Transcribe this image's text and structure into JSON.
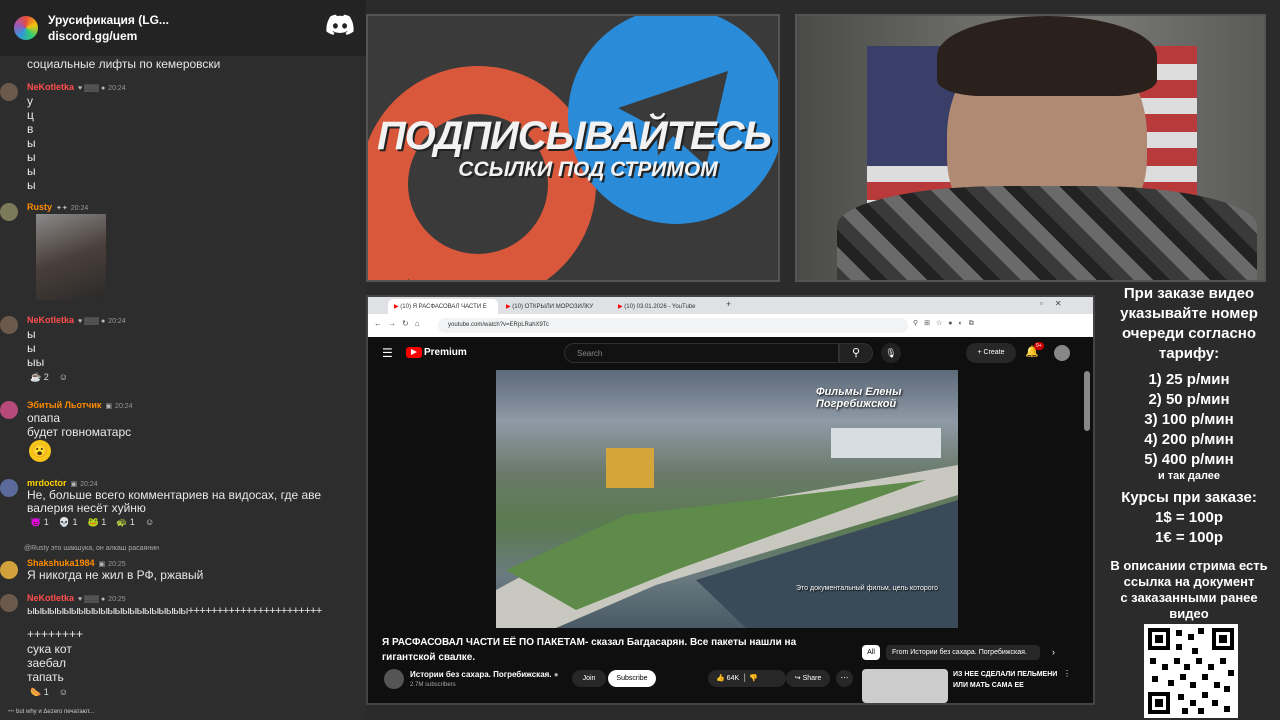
{
  "chat": {
    "server_name": "Урусификация (LG...",
    "server_invite": "discord.gg/uem",
    "partial_top_line": "социальные лифты по  кемеровски",
    "messages": [
      {
        "user": "NeKotletka",
        "time": "20:24",
        "lines": [
          "у",
          "ц",
          "в",
          "ы",
          "ы",
          "ы",
          "ы"
        ]
      },
      {
        "user": "Rusty",
        "time": "20:24",
        "lines": []
      },
      {
        "user": "NeKotletka",
        "time": "20:24",
        "lines": [
          "ы",
          "ы",
          "ыы"
        ],
        "reactions": [
          "2"
        ]
      },
      {
        "user": "Эбитый Льотчик",
        "time": "20:24",
        "lines": [
          "опапа",
          "будет говноматарс"
        ]
      },
      {
        "user": "mrdoctor",
        "time": "20:24",
        "lines": [
          "Не, больше всего комментариев на видосах, где аве",
          "валерия несёт хуйню"
        ],
        "reactions": [
          "1",
          "1",
          "1",
          "1"
        ]
      },
      {
        "user": "Shakshuka1984",
        "time": "20:25",
        "reply": "@Rusty это шакшука, он алкаш расаянин",
        "lines": [
          "Я никогда не жил в РФ, ржавый"
        ]
      },
      {
        "user": "NeKotletka",
        "time": "20:25",
        "lines": [
          "ыыыыыыыыыыыыыыыыыыыыыы+++++++++++++++++++++++",
          "++++++++",
          "сука кот",
          "заебал",
          "тапать"
        ],
        "reactions": [
          "1"
        ]
      }
    ],
    "typing": "but why и Δezero печатают..."
  },
  "promo": {
    "line1": "ПОДПИСЫВАЙТЕСЬ",
    "line2": "ССЫЛКИ ПОД СТРИМОМ"
  },
  "browser": {
    "tabs": [
      "(10) Я РАСФАСОВАЛ ЧАСТИ Е",
      "(10) ОТКРЫЛИ МОРОЗИЛКУ",
      "(10) 03.01.2026 - YouTube"
    ],
    "url": "youtube.com/watch?v=ERpLRahX9Tc",
    "yt_logo": "Premium",
    "search_placeholder": "Search",
    "create_label": "Create",
    "notif_count": "9+",
    "video_watermark": "Фильмы Елены Погребижской",
    "video_caption": "Это документальный фильм, цель которого",
    "video_title": "Я РАСФАСОВАЛ ЧАСТИ ЕЁ ПО ПАКЕТАМ- сказал Багдасарян. Все пакеты нашли на гигантской свалке.",
    "channel_name": "Истории без сахара. Погребижская.",
    "subscribers": "2.7M subscribers",
    "join_label": "Join",
    "subscribe_label": "Subscribe",
    "likes": "64K",
    "share_label": "Share",
    "chip_all": "All",
    "chip_from": "From Истории без сахара. Погребижская.",
    "rec_title": "ИЗ НЕЕ СДЕЛАЛИ ПЕЛЬМЕНИ ИЛИ МАТЬ САМА ЕЕ"
  },
  "info": {
    "header": [
      "При заказе видео",
      "указывайте номер",
      "очереди согласно",
      "тарифу:"
    ],
    "tariffs": [
      "1) 25 р/мин",
      "2) 50 р/мин",
      "3) 100 р/мин",
      "4) 200 р/мин",
      "5) 400 р/мин"
    ],
    "etc": "и так далее",
    "rates_title": "Курсы при заказе:",
    "rates": [
      "1$ = 100р",
      "1€ = 100р"
    ],
    "footer": [
      "В описании стрима есть",
      "ссылка на документ",
      "с заказанными ранее",
      "видео"
    ]
  },
  "colors": {
    "username_red": "#ff4d4d",
    "username_orange": "#ff8c00",
    "username_yellow": "#ffd200",
    "yt_red": "#ff0000",
    "promo_blue": "#2a8bd8",
    "promo_orange": "#d9583b"
  }
}
